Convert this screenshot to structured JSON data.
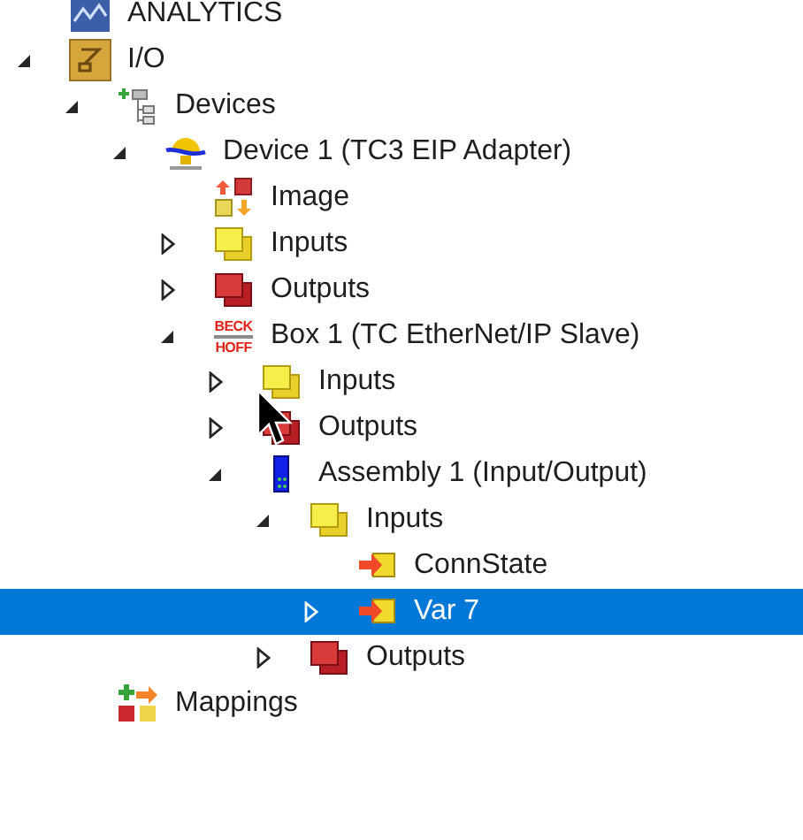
{
  "tree": [
    {
      "label": "ANALYTICS",
      "kind": "analytics",
      "selected": false
    },
    {
      "label": "I/O",
      "kind": "io",
      "expanded": true,
      "selected": false,
      "children": [
        {
          "label": "Devices",
          "kind": "devices",
          "expanded": true,
          "selected": false,
          "children": [
            {
              "label": "Device 1 (TC3 EIP Adapter)",
              "kind": "adapter",
              "expanded": true,
              "selected": false,
              "children": [
                {
                  "label": "Image",
                  "kind": "image",
                  "selected": false
                },
                {
                  "label": "Inputs",
                  "kind": "inputs",
                  "expanded": false,
                  "selected": false
                },
                {
                  "label": "Outputs",
                  "kind": "outputs",
                  "expanded": false,
                  "selected": false
                },
                {
                  "label": "Box 1 (TC EtherNet/IP Slave)",
                  "kind": "logo",
                  "logo_text": [
                    "BECK",
                    "HOFF"
                  ],
                  "expanded": true,
                  "selected": false,
                  "children": [
                    {
                      "label": "Inputs",
                      "kind": "inputs",
                      "expanded": false,
                      "selected": false
                    },
                    {
                      "label": "Outputs",
                      "kind": "outputs",
                      "expanded": false,
                      "selected": false
                    },
                    {
                      "label": "Assembly 1 (Input/Output)",
                      "kind": "assembly",
                      "expanded": true,
                      "selected": false,
                      "children": [
                        {
                          "label": "Inputs",
                          "kind": "inputs",
                          "expanded": true,
                          "selected": false,
                          "children": [
                            {
                              "label": "ConnState",
                              "kind": "variable",
                              "selected": false
                            },
                            {
                              "label": "Var 7",
                              "kind": "variable",
                              "expanded": false,
                              "selected": true
                            }
                          ]
                        },
                        {
                          "label": "Outputs",
                          "kind": "outputs",
                          "expanded": false,
                          "selected": false
                        }
                      ]
                    }
                  ]
                }
              ]
            }
          ]
        },
        {
          "label": "Mappings",
          "kind": "mappings",
          "selected": false
        }
      ]
    }
  ]
}
